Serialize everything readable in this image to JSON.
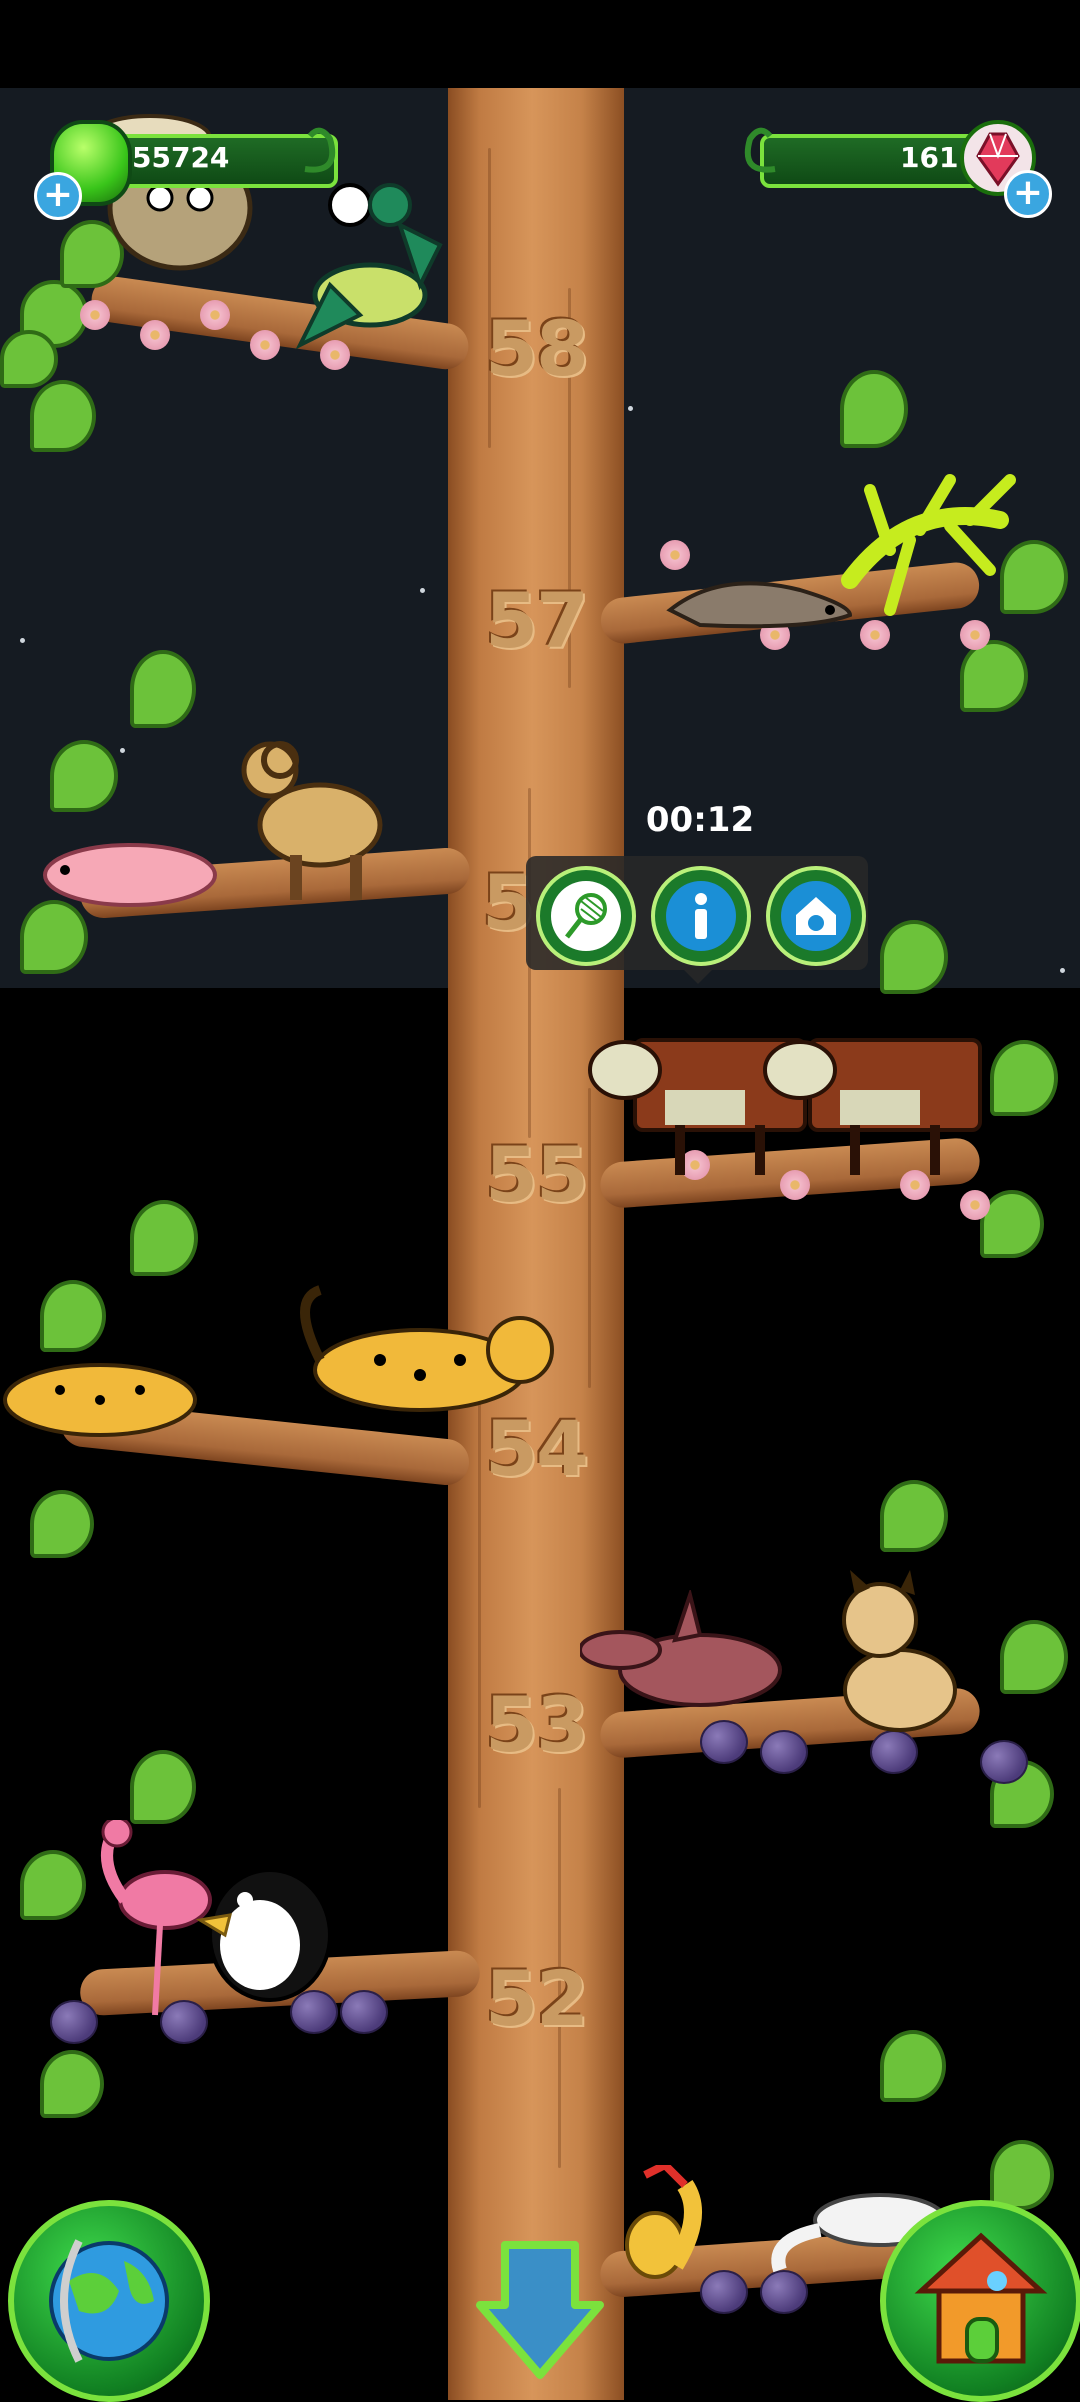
{
  "hud": {
    "coins": {
      "value": "55724",
      "icon": "green-gem-icon",
      "add_icon": "plus-icon"
    },
    "gems": {
      "value": "161",
      "icon": "red-gem-icon",
      "add_icon": "plus-icon"
    }
  },
  "tree": {
    "levels": [
      "58",
      "57",
      "5",
      "55",
      "54",
      "53",
      "52"
    ]
  },
  "popup": {
    "timer": "00:12",
    "buttons": [
      {
        "icon": "net-icon"
      },
      {
        "icon": "info-icon"
      },
      {
        "icon": "pet-house-icon"
      }
    ]
  },
  "bottom": {
    "left_button_icon": "globe-icon",
    "center_button_icon": "down-arrow-icon",
    "right_button_icon": "house-icon"
  },
  "animals": [
    {
      "branch": "58",
      "names": [
        "goat",
        "mantis"
      ]
    },
    {
      "branch": "57",
      "names": [
        "weasel",
        "leafy-seadragon"
      ]
    },
    {
      "branch": "56",
      "names": [
        "naked-mole-rat",
        "camel-ram"
      ]
    },
    {
      "branch": "55",
      "names": [
        "cow",
        "cow"
      ]
    },
    {
      "branch": "54",
      "names": [
        "cheetah",
        "cheetah"
      ]
    },
    {
      "branch": "53",
      "names": [
        "aardvark",
        "lynx"
      ]
    },
    {
      "branch": "52",
      "names": [
        "flamingo",
        "penguin"
      ]
    },
    {
      "branch": "51",
      "names": [
        "squirrel",
        "swan"
      ]
    }
  ],
  "colors": {
    "leaf": "#6cc23a",
    "hud_green": "#7be23d",
    "trunk": "#c07b43"
  }
}
